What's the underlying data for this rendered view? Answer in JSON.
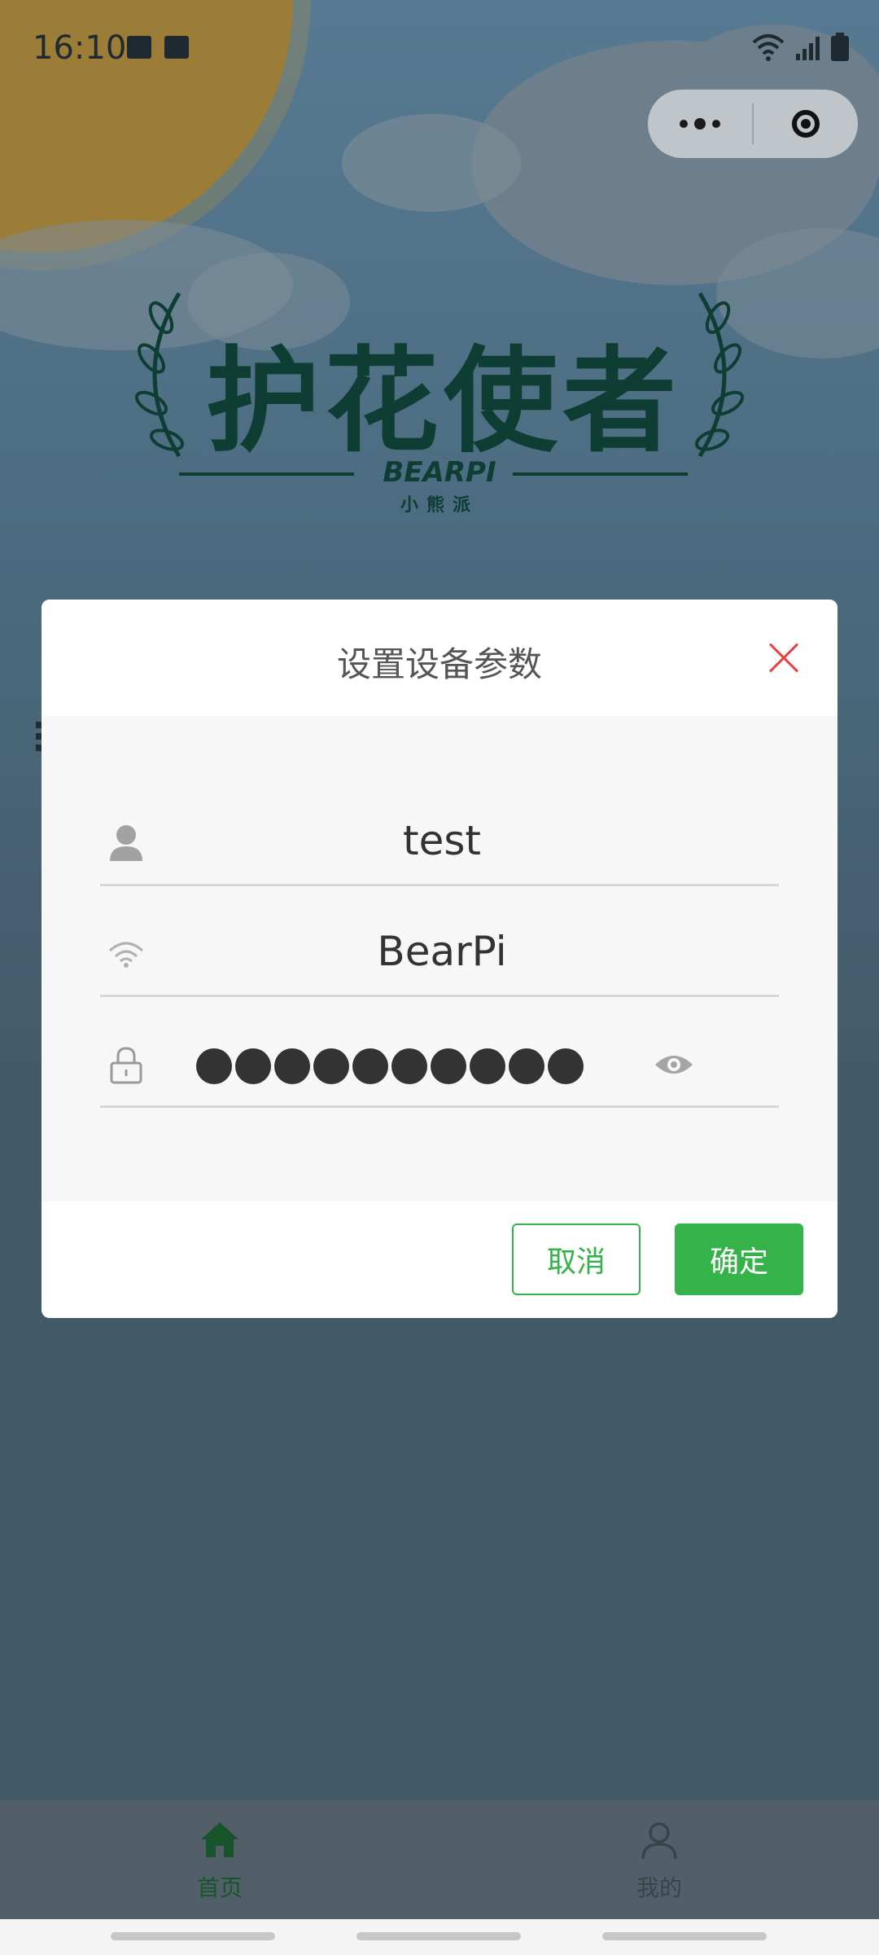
{
  "status_bar": {
    "time": "16:10",
    "icons": [
      "image-icon",
      "media-icon",
      "wifi-icon",
      "signal-icon",
      "battery-icon"
    ]
  },
  "capsule": {
    "more": "more-icon",
    "close": "target-icon"
  },
  "logo": {
    "title": "护花使者",
    "brand": "BEARPI",
    "subtitle": "小熊派"
  },
  "dialog": {
    "title": "设置设备参数",
    "fields": {
      "device_name": {
        "icon": "user-icon",
        "value": "test"
      },
      "wifi_ssid": {
        "icon": "wifi-icon",
        "value": "BearPi"
      },
      "wifi_password": {
        "icon": "lock-icon",
        "masked_length": 10,
        "toggle": "eye-icon"
      }
    },
    "cancel_label": "取消",
    "confirm_label": "确定"
  },
  "tabbar": {
    "items": [
      {
        "label": "首页",
        "icon": "home-icon",
        "active": true
      },
      {
        "label": "我的",
        "icon": "profile-icon",
        "active": false
      }
    ]
  },
  "colors": {
    "accent": "#35b34a",
    "close": "#e8423f",
    "logo": "#0e3d34"
  }
}
